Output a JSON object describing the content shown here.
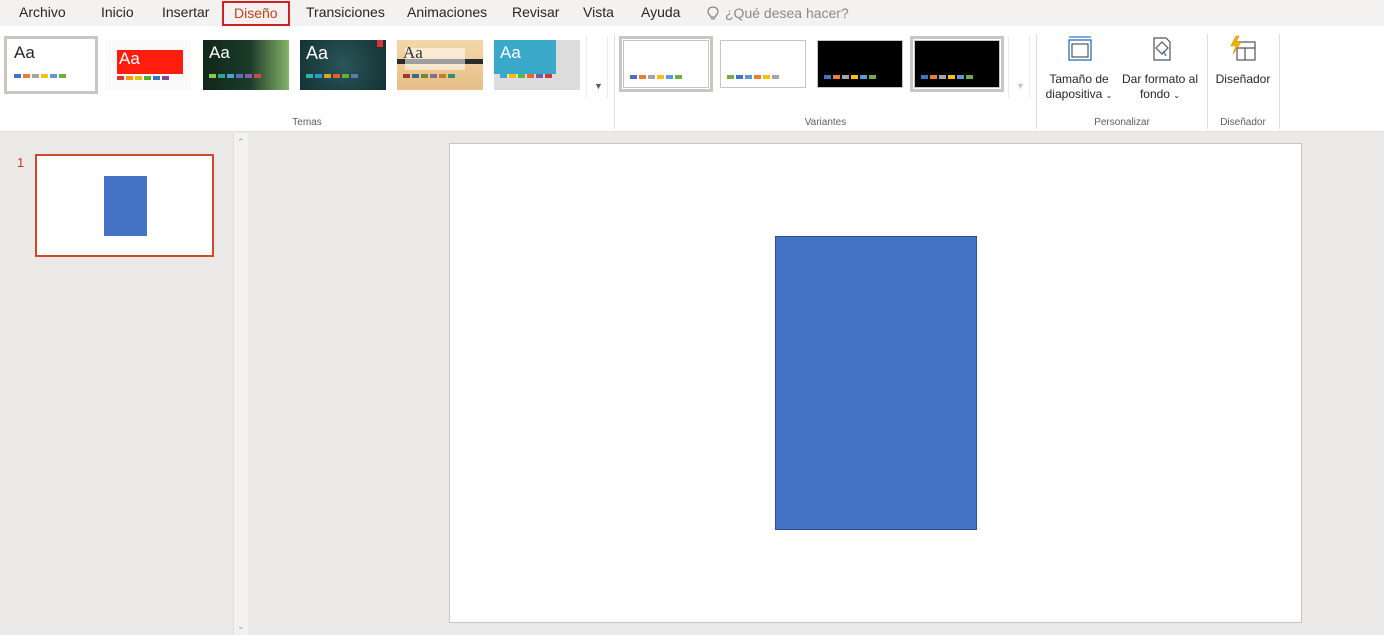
{
  "tabs": [
    {
      "label": "Archivo"
    },
    {
      "label": "Inicio"
    },
    {
      "label": "Insertar"
    },
    {
      "label": "Diseño",
      "active": true
    },
    {
      "label": "Transiciones"
    },
    {
      "label": "Animaciones"
    },
    {
      "label": "Revisar"
    },
    {
      "label": "Vista"
    },
    {
      "label": "Ayuda"
    }
  ],
  "tell_me": {
    "placeholder": "¿Qué desea hacer?",
    "icon": "lightbulb-icon"
  },
  "ribbon": {
    "themes": {
      "label": "Temas",
      "items": [
        {
          "aa": "Aa",
          "bg": "#ffffff",
          "text": "#262626",
          "accent": "#ffffff"
        },
        {
          "aa": "Aa",
          "bg": "#ffffff",
          "text": "#ffffff",
          "accent": "#ff1e0e"
        },
        {
          "aa": "Aa",
          "bg": "#1d3b2a",
          "text": "#ffffff",
          "accent": "#6a9a5a"
        },
        {
          "aa": "Aa",
          "bg": "#1a3a3a",
          "text": "#ffffff",
          "accent": "#e03030"
        },
        {
          "aa": "Aa",
          "bg": "#e8c89a",
          "text": "#333333",
          "accent": "#2b2b2b"
        },
        {
          "aa": "Aa",
          "bg": "#3aa9c9",
          "text": "#ffffff",
          "accent": "#dcdcdc"
        }
      ]
    },
    "variants": {
      "label": "Variantes",
      "items": [
        {
          "bg": "#ffffff"
        },
        {
          "bg": "#ffffff"
        },
        {
          "bg": "#000000"
        },
        {
          "bg": "#000000"
        }
      ]
    },
    "customize": {
      "label": "Personalizar",
      "slide_size": "Tamaño de diapositiva",
      "format_background": "Dar formato al fondo"
    },
    "designer": {
      "label": "Diseñador",
      "button": "Diseñador"
    }
  },
  "slides": [
    {
      "number": "1"
    }
  ],
  "colors": {
    "shape_fill": "#4472c4",
    "active_tab": "#c43e1c",
    "tab_highlight": "#d21f1f"
  }
}
